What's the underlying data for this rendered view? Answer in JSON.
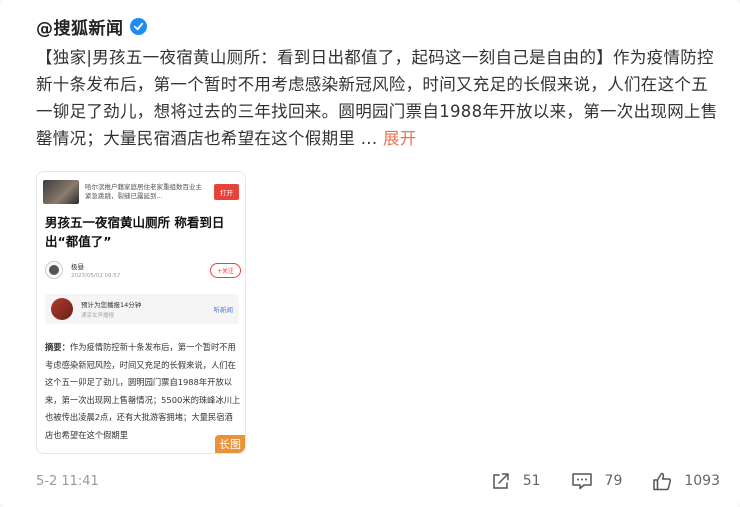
{
  "post": {
    "author": "@搜狐新闻",
    "text": "【独家|男孩五一夜宿黄山厕所：看到日出都值了，起码这一刻自己是自由的】作为疫情防控新十条发布后，第一个暂时不用考虑感染新冠风险，时间又充足的长假来说，人们在这个五一铆足了劲儿，想将过去的三年找回来。圆明园门票自1988年开放以来，第一次出现网上售罄情况；大量民宿酒店也希望在这个假期里 ...",
    "expand_label": "展开",
    "time": "5-2 11:41"
  },
  "long_image": {
    "top_text": "哈尔滨推户籍家庭居住老家重组数百业主紧急跳跳，裂缝已露延到...",
    "open_label": "打开",
    "title": "男孩五一夜宿黄山厕所 称看到日出“都值了”",
    "source_name": "极昼",
    "source_date": "2023/05/02 09:57",
    "follow_label": "+关注",
    "audio_main": "预计为您播报14分钟",
    "audio_sub": "通享女声播报",
    "listen_label": "听新闻",
    "summary_label": "摘要：",
    "summary": "作为疫情防控新十条发布后，第一个暂时不用考虑感染新冠风险，时间又充足的长假来说，人们在这个五一卯足了劲儿，圆明园门票自1988年开放以来，第一次出现网上售罄情况；5500米的珠峰冰川上也被传出凌晨2点，还有大批游客拥堵；大量民宿酒店也希望在这个假期里",
    "badge": "长图"
  },
  "actions": {
    "share_count": "51",
    "comment_count": "79",
    "like_count": "1093"
  },
  "colors": {
    "accent": "#eb7350",
    "verified": "#1d8cf8"
  }
}
